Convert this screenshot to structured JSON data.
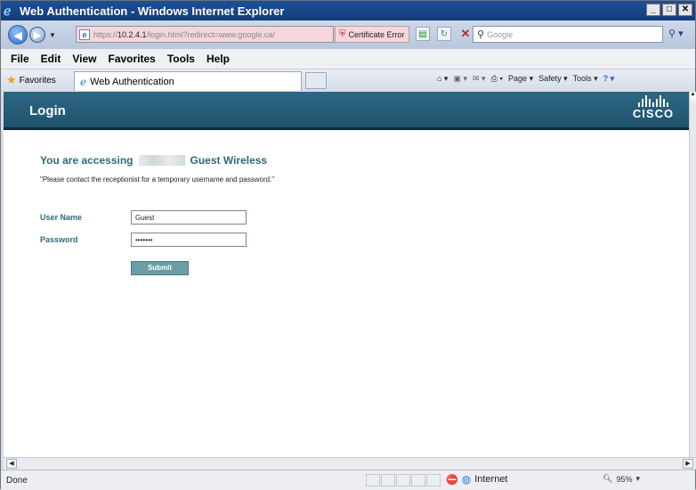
{
  "window": {
    "title": "Web Authentication - Windows Internet Explorer",
    "controls": {
      "minimize": "_",
      "maximize": "□",
      "close": "✕"
    }
  },
  "address_bar": {
    "url_prefix": "https://",
    "url_host": "10.2.4.1",
    "url_rest": "/login.html?redirect=www.google.ca/",
    "cert_error": "Certificate Error",
    "search_placeholder": "Google"
  },
  "menu": [
    "File",
    "Edit",
    "View",
    "Favorites",
    "Tools",
    "Help"
  ],
  "favorites_bar": {
    "favorites_label": "Favorites",
    "tab_title": "Web Authentication",
    "commands": [
      "Page ▾",
      "Safety ▾",
      "Tools ▾"
    ]
  },
  "page": {
    "banner_title": "Login",
    "logo_word": "CISCO",
    "heading_prefix": "You are accessing",
    "heading_suffix": "Guest Wireless",
    "note": "\"Please contact the receptionist for a temporary username and password.\"",
    "username_label": "User Name",
    "username_value": "Guest",
    "password_label": "Password",
    "password_value": "•••••••",
    "submit_label": "Submit"
  },
  "status_bar": {
    "status_text": "Done",
    "zone": "Internet",
    "zoom": "95%"
  },
  "colors": {
    "banner": "#2e6784",
    "label_teal": "#2e6a7a",
    "submit": "#6a9ea4",
    "title_bar": "#1d4f9a"
  }
}
